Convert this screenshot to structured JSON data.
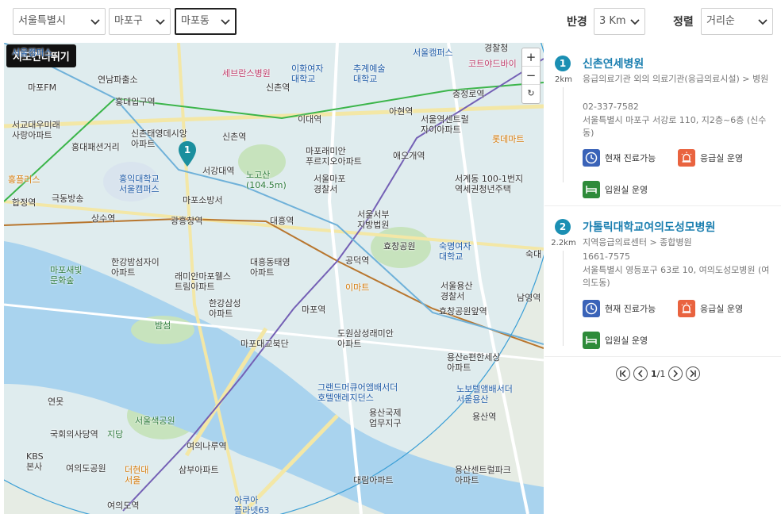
{
  "filters": {
    "city": "서울특별시",
    "district": "마포구",
    "dong": "마포동",
    "radius_label": "반경",
    "radius": "3 Km",
    "sort_label": "정렬",
    "sort": "거리순"
  },
  "map": {
    "toggle_button": "지도건너뛰기",
    "zoom_in": "+",
    "zoom_out": "−",
    "refresh": "↻",
    "pin_number": "1",
    "labels": [
      {
        "text": "마포FM",
        "cls": ""
      },
      {
        "text": "연남파출소",
        "cls": ""
      },
      {
        "text": "홍대입구역",
        "cls": ""
      },
      {
        "text": "서교대우미래\n사랑아파트",
        "cls": ""
      },
      {
        "text": "홍대패션거리",
        "cls": ""
      },
      {
        "text": "신촌태영데시앙\n아파트",
        "cls": ""
      },
      {
        "text": "신촌역",
        "cls": ""
      },
      {
        "text": "서강대역",
        "cls": ""
      },
      {
        "text": "노고산\n(104.5m)",
        "cls": "g"
      },
      {
        "text": "홍익대학교\n서울캠퍼스",
        "cls": "b"
      },
      {
        "text": "홍플러스",
        "cls": "o"
      },
      {
        "text": "합정역",
        "cls": ""
      },
      {
        "text": "극동방송",
        "cls": ""
      },
      {
        "text": "마포소방서",
        "cls": ""
      },
      {
        "text": "상수역",
        "cls": ""
      },
      {
        "text": "광흥창역",
        "cls": ""
      },
      {
        "text": "대흥역",
        "cls": ""
      },
      {
        "text": "세브란스병원",
        "cls": "p"
      },
      {
        "text": "이화여자\n대학교",
        "cls": "b"
      },
      {
        "text": "추계예술\n대학교",
        "cls": "b"
      },
      {
        "text": "신촌역",
        "cls": ""
      },
      {
        "text": "이대역",
        "cls": ""
      },
      {
        "text": "아현역",
        "cls": ""
      },
      {
        "text": "마포래미안\n푸르지오아파트",
        "cls": ""
      },
      {
        "text": "애오개역",
        "cls": ""
      },
      {
        "text": "서울마포\n경찰서",
        "cls": ""
      },
      {
        "text": "서울서부\n지방법원",
        "cls": ""
      },
      {
        "text": "서울캠퍼스",
        "cls": "b"
      },
      {
        "text": "충정로역",
        "cls": ""
      },
      {
        "text": "서울역센트럴\n자이아파트",
        "cls": ""
      },
      {
        "text": "경찰청",
        "cls": ""
      },
      {
        "text": "코트야드바이",
        "cls": "p"
      },
      {
        "text": "롯데마트",
        "cls": "o"
      },
      {
        "text": "서계동 100-1번지\n역세권청년주택",
        "cls": ""
      },
      {
        "text": "효창공원",
        "cls": ""
      },
      {
        "text": "숙명여자\n대학교",
        "cls": "b"
      },
      {
        "text": "숙대",
        "cls": ""
      },
      {
        "text": "한강밤섬자이\n아파트",
        "cls": ""
      },
      {
        "text": "대흥동태영\n아파트",
        "cls": ""
      },
      {
        "text": "공덕역",
        "cls": ""
      },
      {
        "text": "마포새빛\n문화숲",
        "cls": "g"
      },
      {
        "text": "래미안마포웰스\n트림아파트",
        "cls": ""
      },
      {
        "text": "이마트",
        "cls": "o"
      },
      {
        "text": "서울용산\n경찰서",
        "cls": ""
      },
      {
        "text": "남영역",
        "cls": ""
      },
      {
        "text": "한강삼성\n아파트",
        "cls": ""
      },
      {
        "text": "마포역",
        "cls": ""
      },
      {
        "text": "효창공원앞역",
        "cls": ""
      },
      {
        "text": "밤섬",
        "cls": "g"
      },
      {
        "text": "마포대교북단",
        "cls": ""
      },
      {
        "text": "도원삼성래미안\n아파트",
        "cls": ""
      },
      {
        "text": "용산e편한세상\n아파트",
        "cls": ""
      },
      {
        "text": "그랜드머큐어앰배서더\n호텔앤레지던스",
        "cls": "b"
      },
      {
        "text": "노보텔앰배서더\n서울용산",
        "cls": "b"
      },
      {
        "text": "연못",
        "cls": ""
      },
      {
        "text": "용산국제\n업무지구",
        "cls": ""
      },
      {
        "text": "용산역",
        "cls": ""
      },
      {
        "text": "서울색공원",
        "cls": "g"
      },
      {
        "text": "국회의사당역",
        "cls": ""
      },
      {
        "text": "지당",
        "cls": "g"
      },
      {
        "text": "여의나루역",
        "cls": ""
      },
      {
        "text": "KBS\n본사",
        "cls": ""
      },
      {
        "text": "여의도공원",
        "cls": ""
      },
      {
        "text": "더현대\n서울",
        "cls": "o"
      },
      {
        "text": "삼부아파트",
        "cls": ""
      },
      {
        "text": "대림아파트",
        "cls": ""
      },
      {
        "text": "용산센트럴파크\n아파트",
        "cls": ""
      },
      {
        "text": "여의도역",
        "cls": ""
      },
      {
        "text": "아쿠아\n플라넷63",
        "cls": "b"
      },
      {
        "text": "서울캠퍼스",
        "cls": "b"
      }
    ]
  },
  "results": [
    {
      "number": "1",
      "distance": "2km",
      "name": "신촌연세병원",
      "type": "응급의료기관 외의 의료기관(응급의료시설) > 병원",
      "phone": "02-337-7582",
      "address": "서울특별시 마포구 서강로 110, 지2층~6층 (신수동)",
      "tags": [
        "현재 진료가능",
        "응급실 운영",
        "입원실 운영"
      ]
    },
    {
      "number": "2",
      "distance": "2.2km",
      "name": "가톨릭대학교여의도성모병원",
      "type": "지역응급의료센터 > 종합병원",
      "phone": "1661-7575",
      "address": "서울특별시 영등포구 63로 10, 여의도성모병원 (여의도동)",
      "tags": [
        "현재 진료가능",
        "응급실 운영",
        "입원실 운영"
      ]
    }
  ],
  "pagination": {
    "current": "1",
    "separator": "/",
    "total": "1"
  },
  "colors": {
    "accent": "#1b7fb0",
    "badge": "#1b8fb3",
    "river": "#a9d3ee",
    "park": "#c7e3bd"
  }
}
